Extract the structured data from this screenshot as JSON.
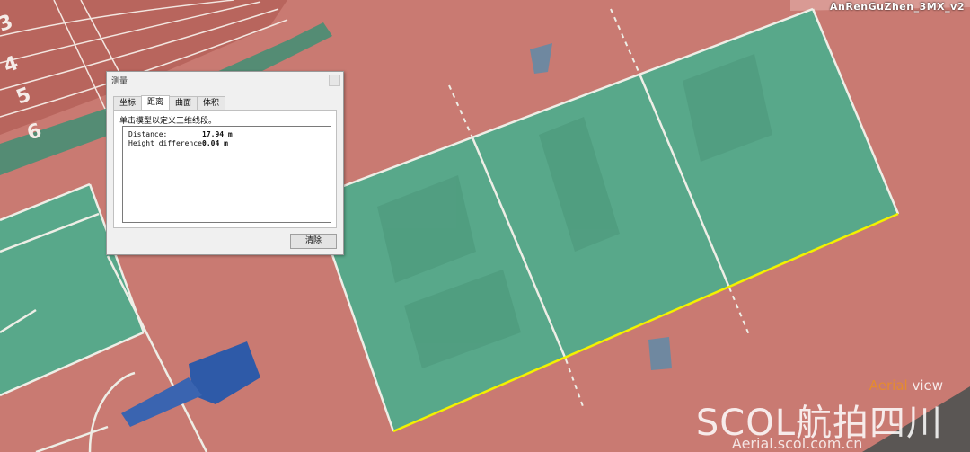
{
  "model": {
    "title": "AnRenGuZhen_3MX_v2"
  },
  "watermark": {
    "main": "SCOL航拍四川",
    "sub_accent": "Aerial",
    "sub_rest": " view",
    "url": "Aerial.scol.com.cn"
  },
  "track": {
    "lane_numbers": [
      "3",
      "4",
      "5",
      "6"
    ]
  },
  "dialog": {
    "title": "测量",
    "tabs": [
      {
        "label": "坐标",
        "active": false
      },
      {
        "label": "距离",
        "active": true
      },
      {
        "label": "曲面",
        "active": false
      },
      {
        "label": "体积",
        "active": false
      }
    ],
    "instruction": "单击模型以定义三维线段。",
    "results": [
      {
        "label": "Distance:",
        "value": "17.94 m"
      },
      {
        "label": "Height difference:",
        "value": "0.04 m"
      }
    ],
    "clear_button": "清除"
  },
  "colors": {
    "track_red": "#c97a72",
    "court_green": "#58a88a",
    "measure_line": "#f2f200",
    "court_line": "#f0f0ea"
  }
}
